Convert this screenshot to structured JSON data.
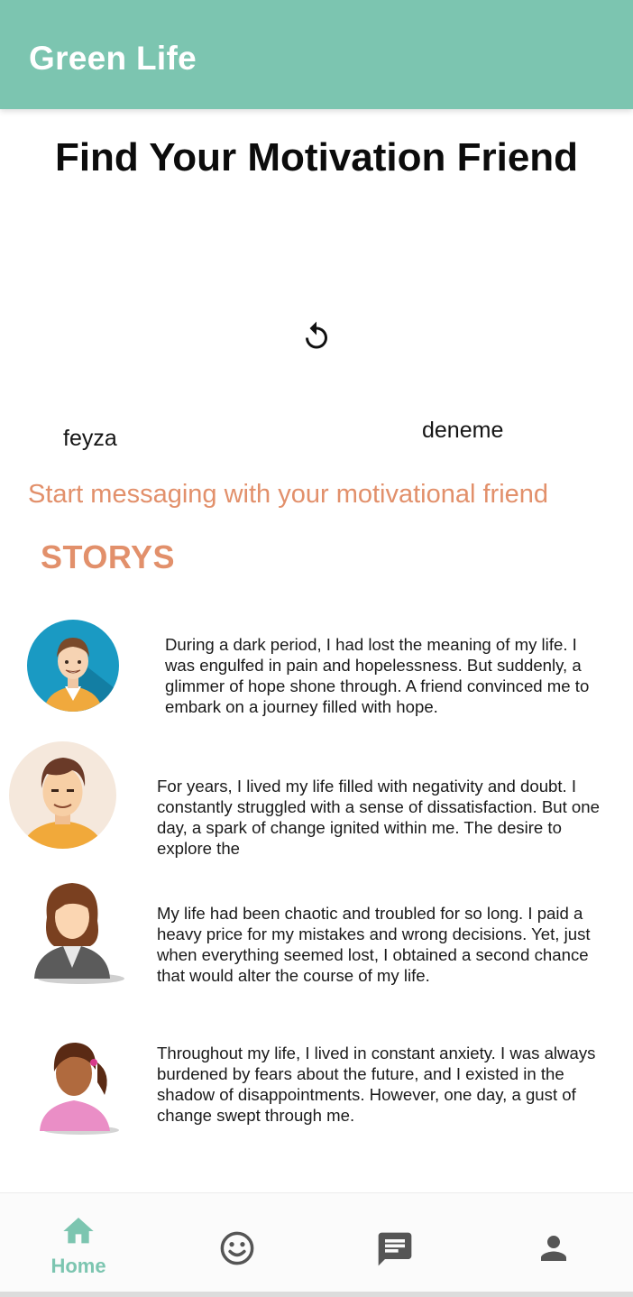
{
  "appbar": {
    "title": "Green Life",
    "color": "#7cc5b0"
  },
  "page": {
    "title": "Find Your Motivation Friend",
    "refresh_icon": "refresh-icon"
  },
  "friends": [
    {
      "name": "feyza"
    },
    {
      "name": "deneme"
    }
  ],
  "start_messaging": "Start messaging with your motivational friend",
  "accent": "#e2906b",
  "stories_section": {
    "title": "STORYS",
    "items": [
      {
        "avatar": "man-avatar-blue-circle",
        "text": "During a dark period, I had lost the meaning of my life. I was engulfed in pain and hopelessness. But suddenly, a glimmer of hope shone through. A friend convinced me to embark on a journey filled with hope."
      },
      {
        "avatar": "man-avatar-beige-circle",
        "text": "For years, I lived my life filled with negativity and doubt. I constantly struggled with a sense of dissatisfaction. But one day, a spark of change ignited within me. The desire to explore the"
      },
      {
        "avatar": "woman-avatar-grey-jacket",
        "text": "My life had been chaotic and troubled for so long. I paid a heavy price for my mistakes and wrong decisions. Yet, just when everything seemed lost, I obtained a second chance that would alter the course of my life."
      },
      {
        "avatar": "girl-avatar-pink-shirt",
        "text": "Throughout my life, I lived in constant anxiety. I was always burdened by fears about the future, and I existed in the shadow of disappointments. However, one day, a gust of change swept through me."
      }
    ]
  },
  "bottom_nav": {
    "items": [
      {
        "icon": "home-icon",
        "label": "Home",
        "active": true
      },
      {
        "icon": "smiley-icon",
        "label": ""
      },
      {
        "icon": "chat-icon",
        "label": ""
      },
      {
        "icon": "person-icon",
        "label": ""
      }
    ],
    "active_color": "#7cc5b0",
    "inactive_color": "#555555"
  }
}
